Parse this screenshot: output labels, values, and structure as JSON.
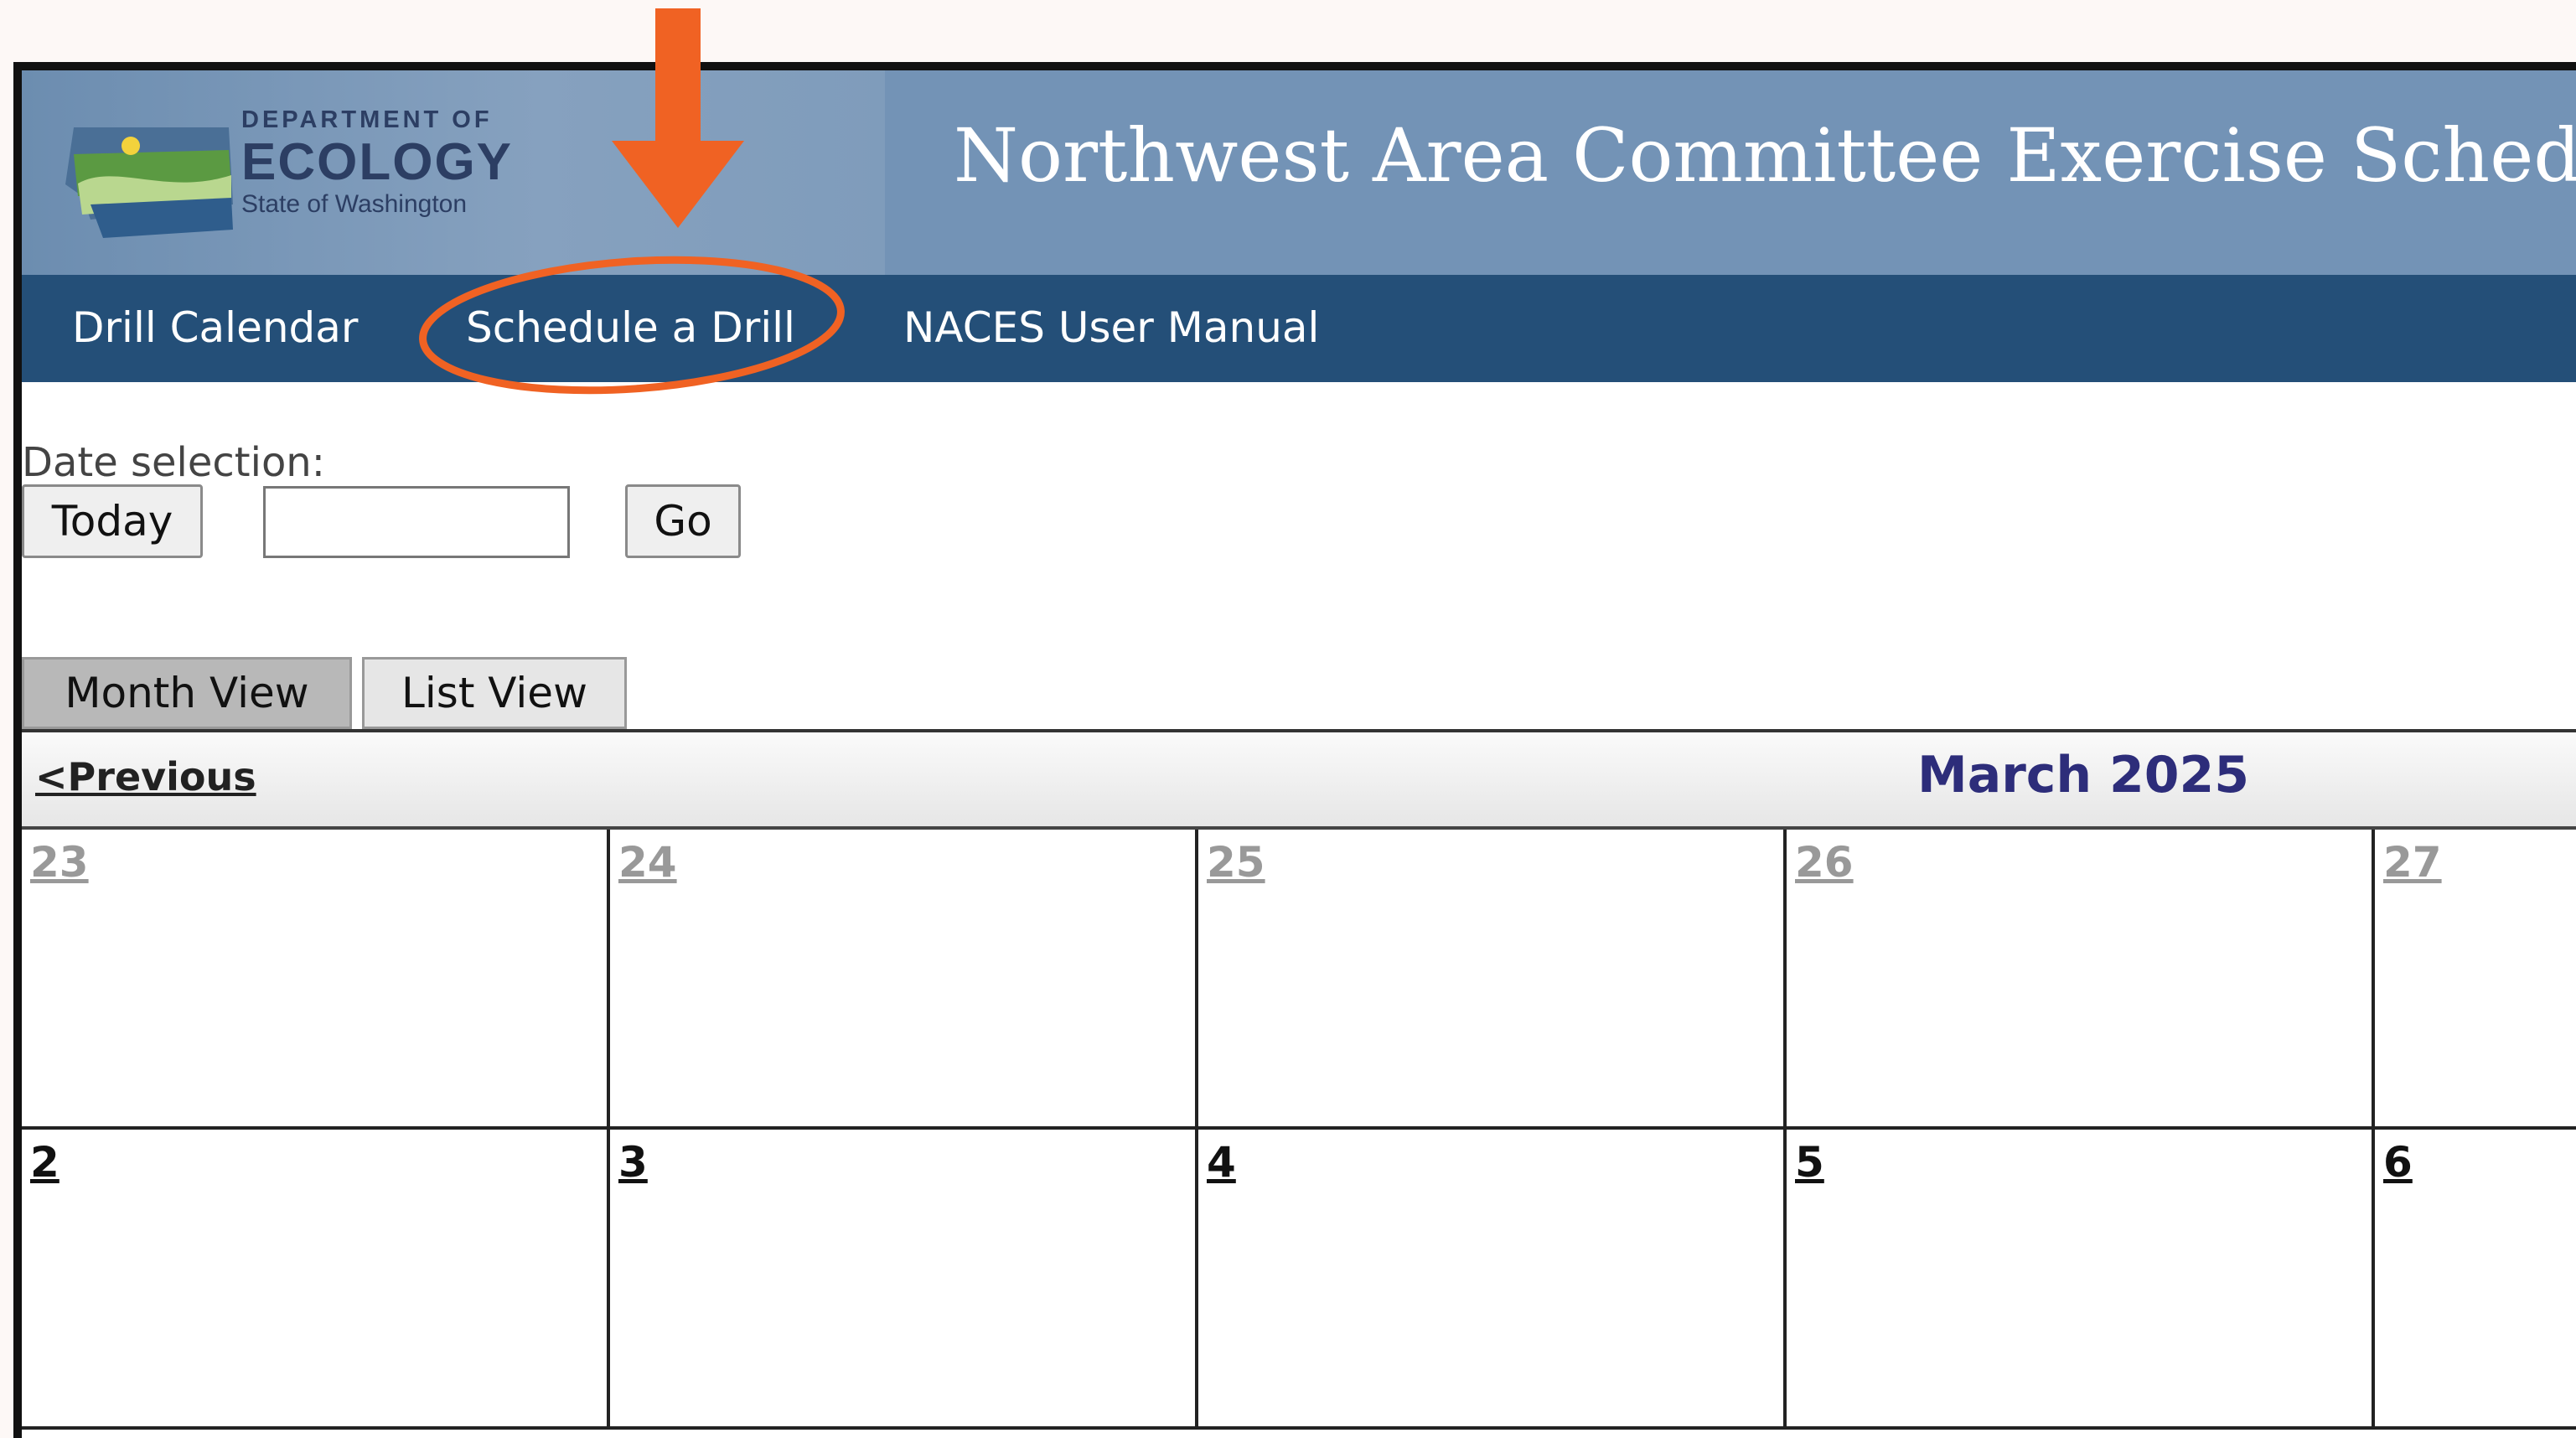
{
  "header": {
    "logo": {
      "line1": "DEPARTMENT OF",
      "line2": "ECOLOGY",
      "line3": "State of Washington"
    },
    "title": "Northwest Area Committee Exercise Schedule"
  },
  "nav": {
    "items": [
      {
        "label": "Drill Calendar"
      },
      {
        "label": "Schedule a Drill"
      },
      {
        "label": "NACES User Manual"
      }
    ]
  },
  "date_selection": {
    "label": "Date selection:",
    "today_label": "Today",
    "input_value": "",
    "go_label": "Go"
  },
  "tabs": [
    {
      "label": "Month View",
      "active": true
    },
    {
      "label": "List View",
      "active": false
    }
  ],
  "calendar": {
    "prev_label": "<Previous",
    "month_title": "March 2025",
    "weeks": [
      [
        "23",
        "24",
        "25",
        "26",
        "27"
      ],
      [
        "2",
        "3",
        "4",
        "5",
        "6"
      ]
    ]
  },
  "colors": {
    "header_bg": "#7393b6",
    "nav_bg": "#244f78",
    "annotation": "#f06223",
    "month_title": "#2d2d7a"
  }
}
